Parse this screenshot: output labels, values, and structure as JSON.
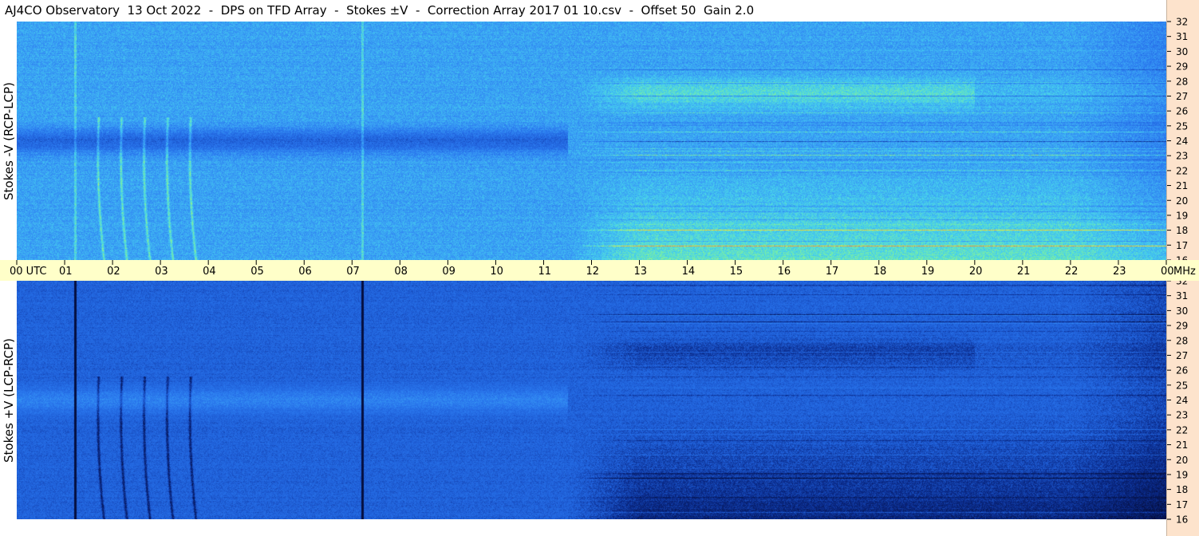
{
  "title": "AJ4CO Observatory  13 Oct 2022  -  DPS on TFD Array  -  Stokes ±V  -  Correction Array 2017 01 10.csv  -  Offset 50  Gain 2.0",
  "chart_data": [
    {
      "type": "heatmap",
      "ylabel": "Stokes -V (RCP-LCP)",
      "y_unit": "MHz",
      "ylim": [
        16,
        32
      ],
      "y_ticks": [
        "32",
        "31",
        "30",
        "29",
        "28",
        "27",
        "26",
        "25",
        "24",
        "23",
        "22",
        "21",
        "20",
        "19",
        "18",
        "17",
        "16"
      ],
      "xlim": [
        0,
        24
      ],
      "colormap": [
        "#0a2a8a",
        "#1f5fd8",
        "#2a78ee",
        "#3aa0f5",
        "#45d0ee",
        "#7cf0a0",
        "#e8ee40",
        "#f0a030",
        "#ff5050"
      ]
    },
    {
      "type": "heatmap",
      "ylabel": "Stokes +V (LCP-RCP)",
      "y_unit": "MHz",
      "ylim": [
        16,
        32
      ],
      "y_ticks": [
        "32",
        "31",
        "30",
        "29",
        "28",
        "27",
        "26",
        "25",
        "24",
        "23",
        "22",
        "21",
        "20",
        "19",
        "18",
        "17",
        "16"
      ],
      "xlim": [
        0,
        24
      ],
      "colormap": [
        "#050f40",
        "#0a2a8a",
        "#1f5fd8",
        "#2a78ee",
        "#3aa0f5",
        "#45d0ee",
        "#7cf0a0"
      ]
    }
  ],
  "time_axis": {
    "labels": [
      "00  UTC",
      "01",
      "02",
      "03",
      "04",
      "05",
      "06",
      "07",
      "08",
      "09",
      "10",
      "11",
      "12",
      "13",
      "14",
      "15",
      "16",
      "17",
      "18",
      "19",
      "20",
      "21",
      "22",
      "23",
      "00"
    ],
    "unit": "MHz"
  }
}
